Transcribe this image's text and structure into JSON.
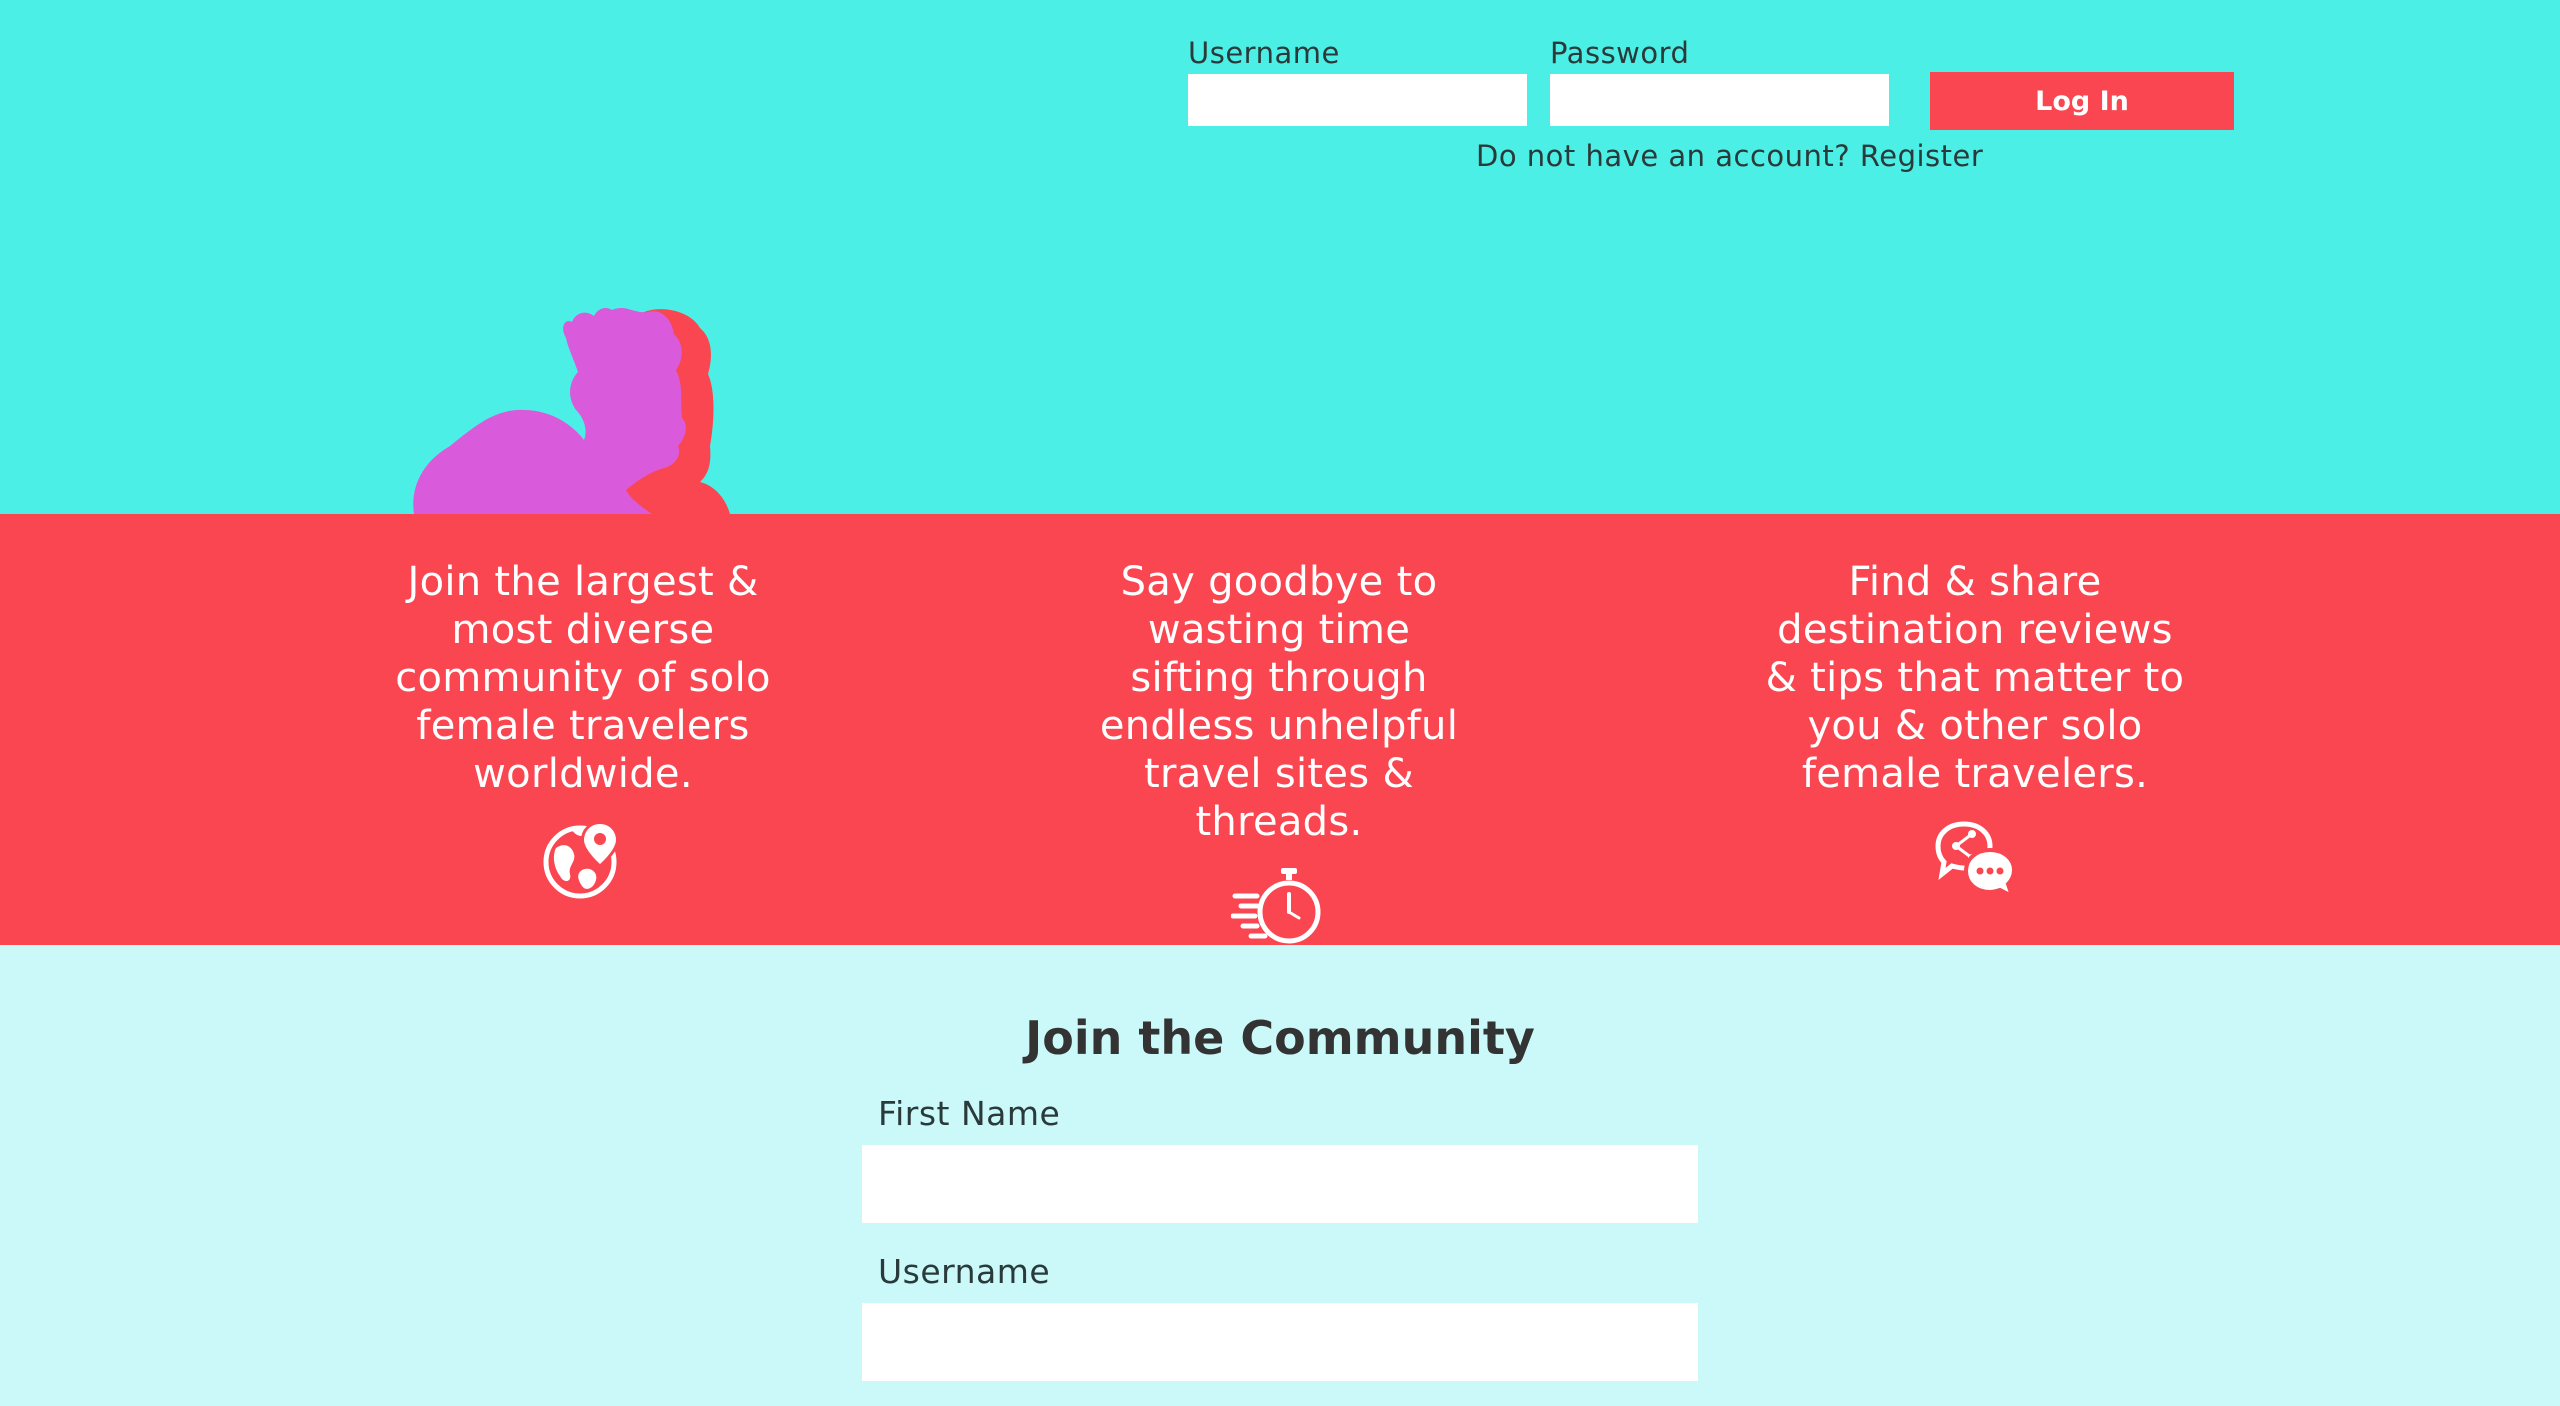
{
  "login": {
    "username_label": "Username",
    "username_value": "",
    "password_label": "Password",
    "password_value": "",
    "button_label": "Log In",
    "register_prompt": "Do not have an account? ",
    "register_link": "Register"
  },
  "features": [
    {
      "text": "Join the largest & most diverse community of solo female travelers worldwide.",
      "icon": "globe-pin-icon"
    },
    {
      "text": "Say goodbye to wasting time sifting through endless unhelpful travel sites & threads.",
      "icon": "stopwatch-icon"
    },
    {
      "text": "Find & share destination reviews & tips that matter to you & other solo female travelers.",
      "icon": "chat-share-icon"
    }
  ],
  "join": {
    "title": "Join the Community",
    "first_name_label": "First Name",
    "first_name_value": "",
    "username_label": "Username",
    "username_value": ""
  },
  "colors": {
    "hero_bg": "#4cefe6",
    "accent_red": "#fa4650",
    "silhouette_magenta": "#d95bdb",
    "join_bg": "#cbf9fa",
    "text_dark": "#2a3a3a"
  }
}
